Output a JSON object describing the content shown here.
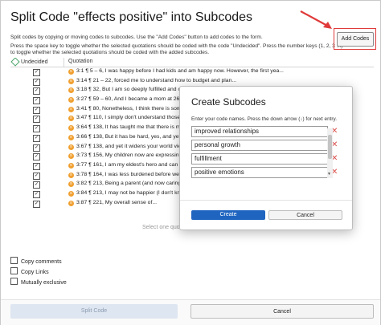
{
  "dialog": {
    "title": "Split Code \"effects positive\" into Subcodes",
    "desc1": "Split codes by copying or moving codes to subcodes. Use the \"Add Codes\" button to add codes to the form.",
    "desc2": "Press the space key to toggle whether the selected quotations should be coded with the code \"Undecided\". Press the number keys (1, 2, 3 ...)",
    "desc3": "to toggle whether the selected quotations should be coded with the added subcodes.",
    "add_codes_label": "Add Codes",
    "col_undecided": "Undecided",
    "col_quotation": "Quotation",
    "quotations": [
      {
        "checked": true,
        "text": "3:1 ¶ 5 – 6, I was happy before I had kids and am happy now. However, the first yea..."
      },
      {
        "checked": true,
        "text": "3:14 ¶ 21 – 22, forced me to understand how to budget and plan..."
      },
      {
        "checked": true,
        "text": "3:18 ¶ 32, But I am so deeply fulfilled and con..."
      },
      {
        "checked": true,
        "text": "3:27 ¶ 59 – 60, And I became a mom at 26, on..."
      },
      {
        "checked": true,
        "text": "3:41 ¶ 80, Nonetheless, I think there is someth..."
      },
      {
        "checked": true,
        "text": "3:47 ¶ 110, I simply don't understand those wh..."
      },
      {
        "checked": true,
        "text": "3:64 ¶ 138, It has taught me that there is mo..."
      },
      {
        "checked": true,
        "text": "3:66 ¶ 138, But it has be hard, yes, and yet it wide..."
      },
      {
        "checked": true,
        "text": "3:67 ¶ 138, and yet it widens your world view..."
      },
      {
        "checked": true,
        "text": "3:73 ¶ 156, My children now are expressing th..."
      },
      {
        "checked": true,
        "text": "3:77 ¶ 161, I am my eldest's hero and can be..."
      },
      {
        "checked": true,
        "text": "3:78 ¶ 164, I was less burdened before we ha..."
      },
      {
        "checked": true,
        "text": "3:82 ¶ 213, Being a parent (and now caring f..."
      },
      {
        "checked": true,
        "text": "3:84 ¶ 213, I may not be happier (I don't kn..."
      },
      {
        "checked": true,
        "text": "3:87 ¶ 221, My overall sense of..."
      }
    ],
    "placeholder": "Select one quotation",
    "copy_comments": "Copy comments",
    "copy_links": "Copy Links",
    "mutually_exclusive": "Mutually exclusive",
    "split_code_label": "Split Code",
    "cancel_label": "Cancel"
  },
  "modal": {
    "title": "Create Subcodes",
    "hint": "Enter your code names. Press the down arrow (↓) for next entry.",
    "fields": [
      "improved relationships",
      "personal growth",
      "fulfillment",
      "positive emotions"
    ],
    "create_label": "Create",
    "cancel_label": "Cancel"
  },
  "colors": {
    "accent": "#1f65c0",
    "highlight": "#e03a3a",
    "quote_icon": "#f0a030",
    "undecided_icon": "#4aa36b"
  }
}
